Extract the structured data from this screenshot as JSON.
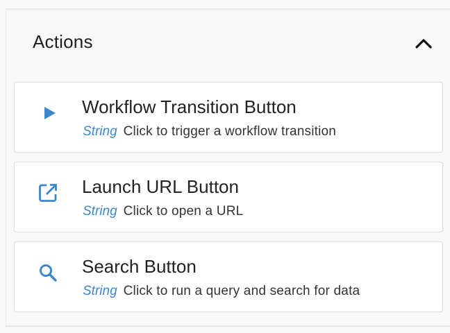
{
  "section": {
    "title": "Actions",
    "collapse_icon": "chevron-up-icon"
  },
  "colors": {
    "accent": "#3d86cc",
    "title_text": "#222222",
    "card_border": "#dedede",
    "panel_bg": "#f8f8f8"
  },
  "actions": [
    {
      "icon": "play-icon",
      "title": "Workflow Transition Button",
      "type": "String",
      "description": "Click to trigger a workflow transition"
    },
    {
      "icon": "open-in-new-icon",
      "title": "Launch URL Button",
      "type": "String",
      "description": "Click to open a URL"
    },
    {
      "icon": "search-icon",
      "title": "Search Button",
      "type": "String",
      "description": "Click to run a query and search for data"
    }
  ]
}
